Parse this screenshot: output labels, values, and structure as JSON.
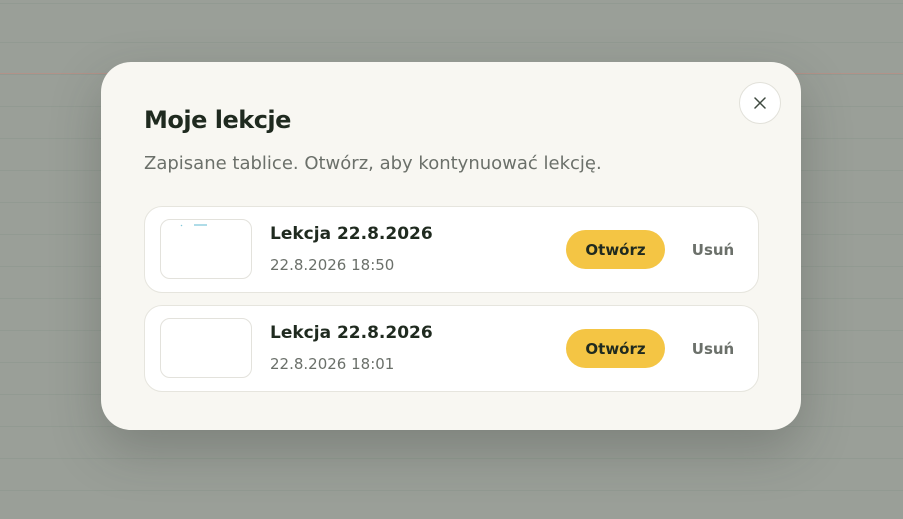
{
  "dialog": {
    "title": "Moje lekcje",
    "subtitle": "Zapisane tablice. Otwórz, aby kontynuować lekcję.",
    "close_icon": "close-icon"
  },
  "lessons": [
    {
      "title": "Lekcja 22.8.2026",
      "date": "22.8.2026 18:50",
      "open_label": "Otwórz",
      "delete_label": "Usuń"
    },
    {
      "title": "Lekcja 22.8.2026",
      "date": "22.8.2026 18:01",
      "open_label": "Otwórz",
      "delete_label": "Usuń"
    }
  ],
  "colors": {
    "accent": "#f4c544",
    "backdrop": "#9a9f98",
    "modal": "#f8f7f2",
    "text_dark": "#1f2a1f",
    "text_muted": "#6b706a"
  }
}
